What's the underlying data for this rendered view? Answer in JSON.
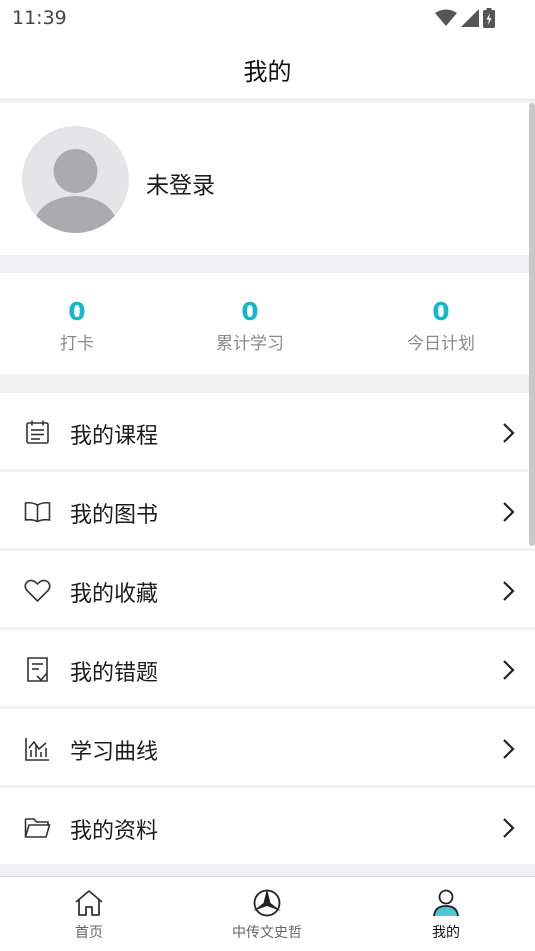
{
  "status_bar": {
    "time": "11:39",
    "icons": [
      "wifi-icon",
      "signal-icon",
      "battery-icon"
    ]
  },
  "header": {
    "title": "我的"
  },
  "profile": {
    "name": "未登录",
    "avatar_icon": "default-avatar-icon"
  },
  "stats": [
    {
      "value": "0",
      "label": "打卡"
    },
    {
      "value": "0",
      "label": "累计学习"
    },
    {
      "value": "0",
      "label": "今日计划"
    }
  ],
  "menu": {
    "items": [
      {
        "label": "我的课程",
        "icon": "calendar-icon"
      },
      {
        "label": "我的图书",
        "icon": "book-icon"
      },
      {
        "label": "我的收藏",
        "icon": "heart-icon"
      },
      {
        "label": "我的错题",
        "icon": "notes-icon"
      },
      {
        "label": "学习曲线",
        "icon": "chart-icon"
      },
      {
        "label": "我的资料",
        "icon": "folder-icon"
      }
    ]
  },
  "bottom_nav": {
    "items": [
      {
        "label": "首页",
        "icon": "home-icon"
      },
      {
        "label": "中传文史哲",
        "icon": "brand-logo-icon"
      },
      {
        "label": "我的",
        "icon": "user-icon",
        "active": true
      }
    ]
  },
  "colors": {
    "accent": "#14b8cc",
    "background": "#f0f1f3",
    "avatar_bg": "#e4e5e7",
    "avatar_fg": "#a9abae",
    "active_tab_icon": "#4cc7d4"
  }
}
